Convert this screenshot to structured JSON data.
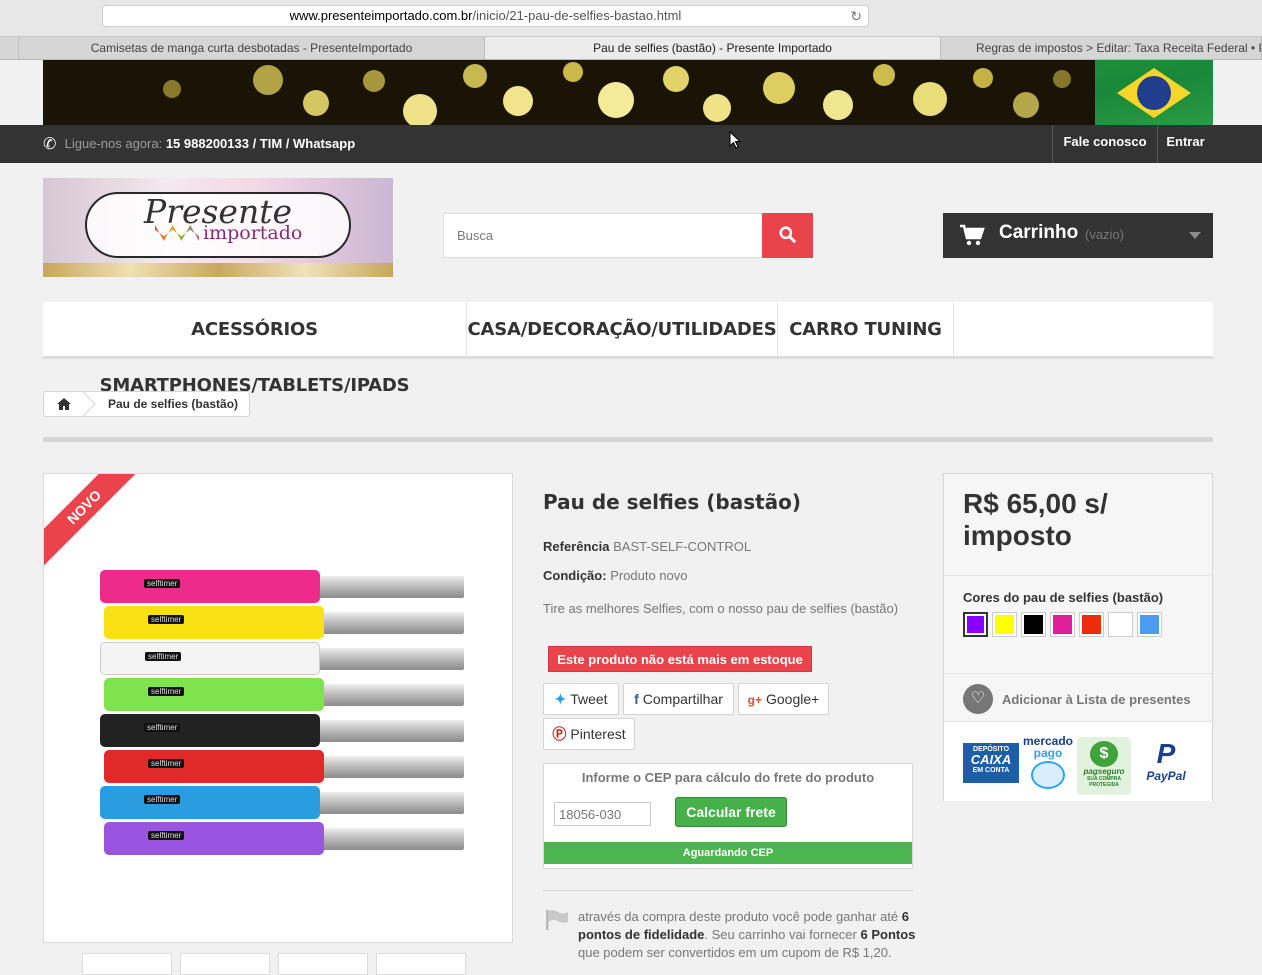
{
  "browser": {
    "url_domain": "www.presenteimportado.com.br",
    "url_path": "/inicio/21-pau-de-selfies-bastao.html",
    "tabs": [
      "Camisetas de manga curta desbotadas - PresenteImportado",
      "Pau de selfies (bastão) - Presente Importado",
      "Regras de impostos > Editar: Taxa Receita Federal • Pr"
    ]
  },
  "topnav": {
    "phone_prefix": "Ligue-nos agora:",
    "phone_number": "15 988200133 / TIM / Whatsapp",
    "contact": "Fale conosco",
    "login": "Entrar"
  },
  "logo": {
    "line1": "Presente",
    "line2": "importado"
  },
  "search": {
    "placeholder": "Busca"
  },
  "cart": {
    "label": "Carrinho",
    "status": "(vazio)"
  },
  "menu": [
    "ACESSÓRIOS SMARTPHONES/TABLETS/IPADS",
    "CASA/DECORAÇÃO/UTILIDADES",
    "CARRO TUNING"
  ],
  "breadcrumb": {
    "current": "Pau de selfies (bastão)"
  },
  "product": {
    "badge": "NOVO",
    "grip_brand": "selftimer",
    "title": "Pau de selfies (bastão)",
    "reference_label": "Referência",
    "reference": "BAST-SELF-CONTROL",
    "condition_label": "Condição:",
    "condition": "Produto novo",
    "description": "Tire as melhores Selfies, com o nosso pau de selfies (bastão)",
    "stock_alert": "Este produto não está mais em estoque",
    "grip_colors": [
      "#ee2b8a",
      "#f9e116",
      "#f4f4f4",
      "#7fe34c",
      "#222222",
      "#e02a2a",
      "#2a9de0",
      "#9a55e0"
    ]
  },
  "share": {
    "tweet": "Tweet",
    "facebook": "Compartilhar",
    "google": "Google+",
    "pinterest": "Pinterest"
  },
  "shipping": {
    "title": "Informe o CEP para cálculo do frete do produto",
    "cep_value": "18056-030",
    "button": "Calcular frete",
    "status": "Aguardando CEP"
  },
  "loyalty": {
    "text1": "através da compra deste produto você pode ganhar até",
    "points": "6 pontos de fidelidade",
    "text2": ". Seu carrinho vai fornecer",
    "points2": "6 Pontos",
    "text3": "que podem ser convertidos em um cupom de R$ 1,20."
  },
  "price_box": {
    "price": "R$ 65,00 s/ imposto",
    "colors_label": "Cores do pau de selfies (bastão)",
    "swatches": [
      "#8a00ff",
      "#ffff00",
      "#000000",
      "#e0209a",
      "#ee2b0c",
      "#ffffff",
      "#4a9cf2"
    ],
    "wishlist": "Adicionar à Lista de presentes",
    "payments": {
      "caixa_top": "DEPÓSITO",
      "caixa_mid": "CAIXA",
      "caixa_bot": "EM CONTA",
      "mercado": "mercado",
      "pago": "pago",
      "pagseguro": "pagseguro",
      "pagseguro_sub": "SUA COMPRA PROTEGIDA",
      "paypal": "PayPal"
    }
  },
  "colors": {
    "accent_red": "#e9434c",
    "dark": "#333333",
    "green": "#46b04a"
  }
}
